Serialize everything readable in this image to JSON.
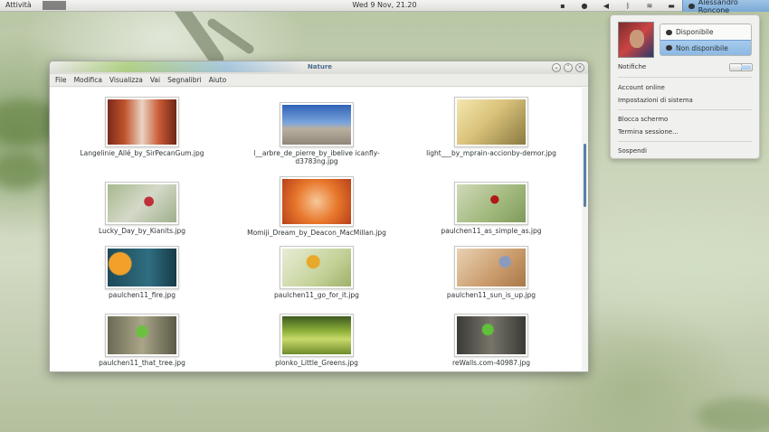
{
  "topbar": {
    "activities": "Attività",
    "clock": "Wed  9 Nov, 21.20",
    "user_name": "Alessandro Roncone",
    "tray_icons": [
      "folder-icon",
      "power-icon",
      "volume-icon",
      "bluetooth-icon",
      "wifi-icon",
      "battery-icon"
    ]
  },
  "user_menu": {
    "status_available": "Disponibile",
    "status_unavailable": "Non disponibile",
    "notifications_label": "Notifiche",
    "notifications_value": "I",
    "items": [
      "Account online",
      "Impostazioni di sistema",
      "Blocca schermo",
      "Termina sessione...",
      "Sospendi"
    ]
  },
  "window": {
    "title": "Nature",
    "menu": [
      "File",
      "Modifica",
      "Visualizza",
      "Vai",
      "Segnalibri",
      "Aiuto"
    ],
    "files": [
      {
        "name": "Langelinie_Allé_by_SirPecanGum.jpg"
      },
      {
        "name": "l__arbre_de_pierre_by_ibelive icanfly-d3783ng.jpg"
      },
      {
        "name": "light___by_mprain-accionby-demor.jpg"
      },
      {
        "name": "Lucky_Day_by_Kianits.jpg"
      },
      {
        "name": "Momiji_Dream_by_Deacon_MacMillan.jpg"
      },
      {
        "name": "paulchen11_as_simple_as.jpg"
      },
      {
        "name": "paulchen11_fire.jpg"
      },
      {
        "name": "paulchen11_go_for_it.jpg"
      },
      {
        "name": "paulchen11_sun_is_up.jpg"
      },
      {
        "name": "paulchen11_that_tree.jpg"
      },
      {
        "name": "plonko_Little_Greens.jpg"
      },
      {
        "name": "reWalls.com-40987.jpg"
      }
    ]
  }
}
